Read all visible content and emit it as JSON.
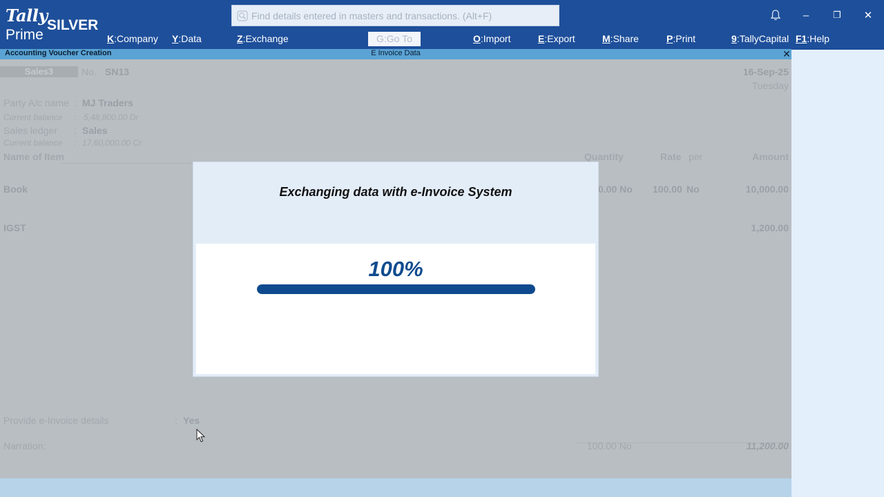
{
  "app": {
    "logo_tally": "Tally",
    "logo_prime": "Prime",
    "edition": "SILVER"
  },
  "search": {
    "placeholder": "Find details entered in masters and transactions. (Alt+F)"
  },
  "window_controls": {
    "bell": "notification-bell",
    "minimize": "–",
    "restore": "❐",
    "close": "✕"
  },
  "menu": [
    {
      "key": "K",
      "label": "Company"
    },
    {
      "key": "Y",
      "label": "Data"
    },
    {
      "key": "Z",
      "label": "Exchange"
    },
    {
      "key": "G",
      "label": "Go To"
    },
    {
      "key": "O",
      "label": "Import"
    },
    {
      "key": "E",
      "label": "Export"
    },
    {
      "key": "M",
      "label": "Share"
    },
    {
      "key": "P",
      "label": "Print"
    },
    {
      "key": "9",
      "label": "TallyCapital"
    },
    {
      "key": "F1",
      "label": "Help"
    }
  ],
  "subheader": {
    "left": "Accounting Voucher Creation",
    "center": "E Invoice Data",
    "close": "✕"
  },
  "voucher": {
    "type": "Sales3",
    "no_label": "No.",
    "no_value": "SN13",
    "date": "16-Sep-25",
    "day": "Tuesday",
    "party_label": "Party A/c name",
    "party_colon": ":",
    "party_value": "MJ Traders",
    "party_balance_label": "Current balance",
    "party_balance_colon": ":",
    "party_balance_value": "5,48,800.00 Dr",
    "sales_label": "Sales ledger",
    "sales_colon": ":",
    "sales_value": "Sales",
    "sales_balance_label": "Current balance",
    "sales_balance_colon": ":",
    "sales_balance_value": "17,60,000.00 Cr",
    "columns": {
      "item": "Name of Item",
      "quantity": "Quantity",
      "rate": "Rate",
      "per": "per",
      "amount": "Amount"
    },
    "items": [
      {
        "name": "Book",
        "quantity": "0.00 No",
        "rate": "100.00",
        "per": "No",
        "amount": "10,000.00"
      }
    ],
    "tax": {
      "name": "IGST",
      "amount": "1,200.00"
    },
    "einvoice_label": "Provide e-Invoice details",
    "einvoice_colon": ":",
    "einvoice_value": "Yes",
    "narration_label": "Narration:",
    "total_quantity": "100.00 No",
    "total_amount": "11,200.00"
  },
  "modal": {
    "title": "Exchanging data with e-Invoice System",
    "percent_text": "100%",
    "progress": 1.0
  },
  "colors": {
    "header": "#1e4f9a",
    "subheader": "#5aa3d4",
    "progress": "#0f4a8e"
  }
}
